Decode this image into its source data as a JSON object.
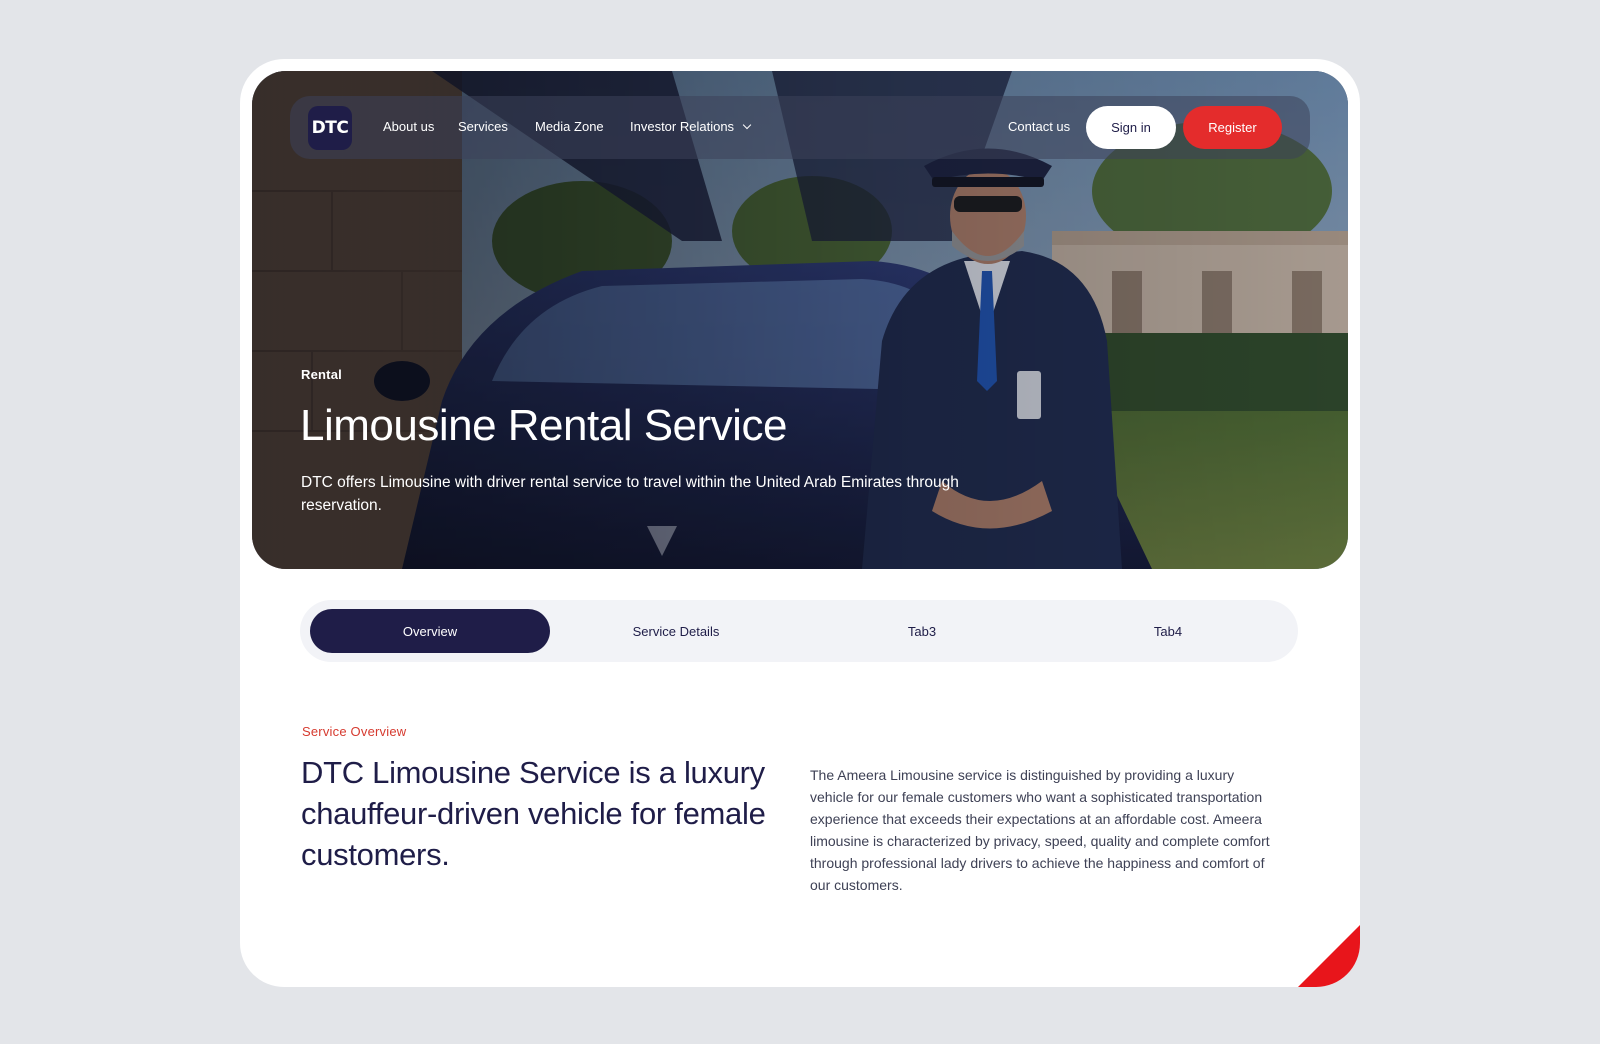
{
  "brand": {
    "logo_text": "DTC",
    "accent": "#e42c2c",
    "navy": "#1f1d48"
  },
  "nav": {
    "links": [
      {
        "label": "About us"
      },
      {
        "label": "Services"
      },
      {
        "label": "Media Zone"
      },
      {
        "label": "Investor Relations",
        "has_dropdown": true
      }
    ],
    "contact_label": "Contact us",
    "signin_label": "Sign in",
    "register_label": "Register"
  },
  "hero": {
    "eyebrow": "Rental",
    "title": "Limousine Rental Service",
    "description": "DTC offers Limousine with driver rental service to travel within the United Arab Emirates through reservation.",
    "image": "chauffeur standing in front of a car with open falcon-wing doors"
  },
  "tabs": [
    {
      "label": "Overview",
      "active": true
    },
    {
      "label": "Service Details",
      "active": false
    },
    {
      "label": "Tab3",
      "active": false
    },
    {
      "label": "Tab4",
      "active": false
    }
  ],
  "overview": {
    "eyebrow": "Service Overview",
    "heading": "DTC Limousine Service is a luxury chauffeur-driven vehicle for female customers.",
    "body": "The Ameera Limousine service is distinguished by providing a luxury vehicle for our female customers who want a sophisticated transportation experience that exceeds their expectations at an affordable cost. Ameera limousine is characterized by privacy, speed, quality and complete comfort through professional lady drivers to achieve the happiness and comfort of our customers."
  }
}
